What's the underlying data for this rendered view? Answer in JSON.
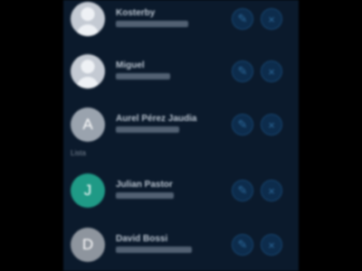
{
  "contacts": [
    {
      "name": "Kosterby",
      "detail": "",
      "avatar": "photo",
      "initial": "",
      "color": "#c9ced6"
    },
    {
      "name": "Miguel",
      "detail": "",
      "avatar": "photo",
      "initial": "",
      "color": "#c9ced6"
    },
    {
      "name": "Aurel Pérez Jaudia",
      "detail": "",
      "avatar": "letter",
      "initial": "A",
      "color": "#9aa3ae"
    },
    {
      "name": "Julian Pastor",
      "detail": "",
      "avatar": "letter",
      "initial": "J",
      "color": "#1f9a86"
    },
    {
      "name": "David Bossi",
      "detail": "",
      "avatar": "letter",
      "initial": "D",
      "color": "#8e959e"
    }
  ],
  "section_label": "Lista",
  "icons": {
    "edit": "pencil-icon",
    "remove": "close-icon"
  }
}
